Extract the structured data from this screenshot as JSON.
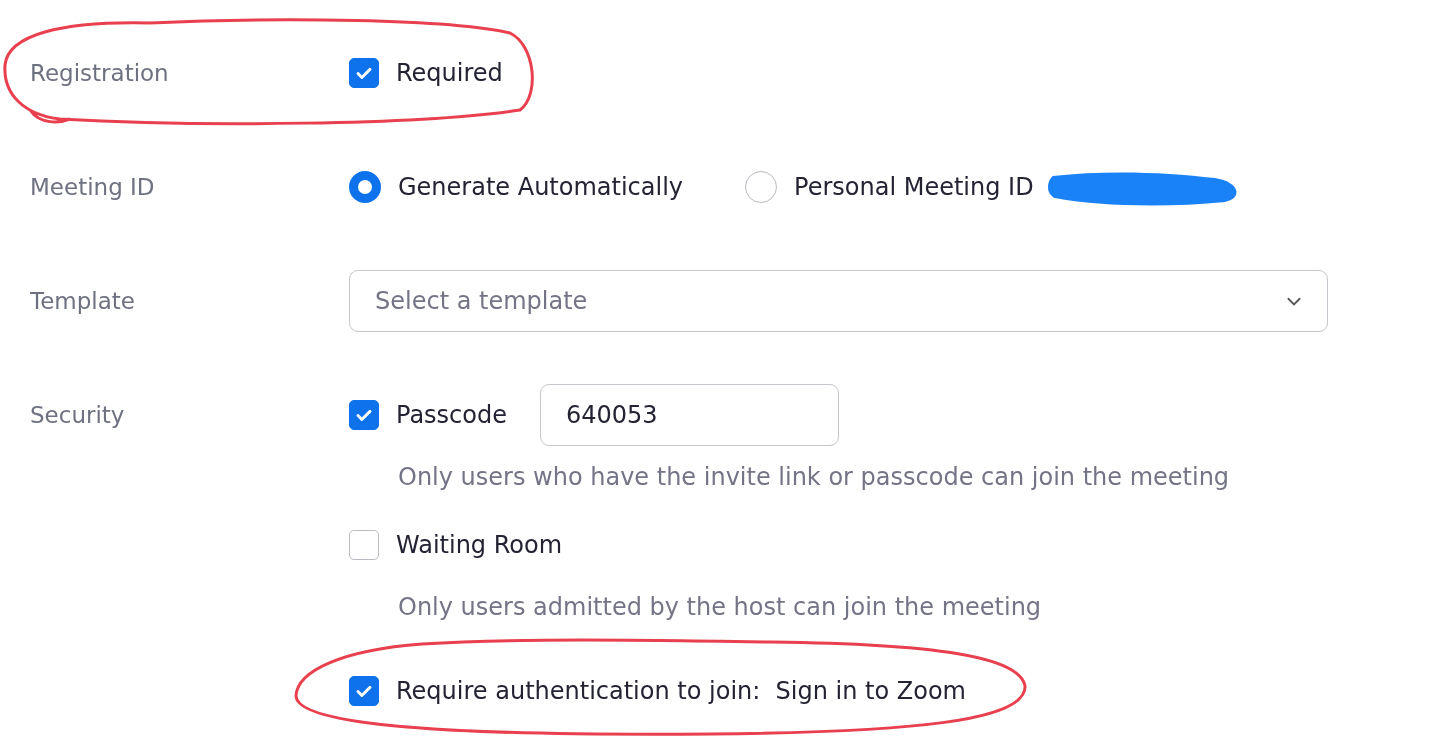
{
  "rows": [
    {
      "label": "Registration",
      "kind": "checkbox",
      "options": [
        {
          "label": "Required",
          "checked": true
        }
      ]
    },
    {
      "label": "Meeting ID",
      "kind": "radio",
      "options": [
        {
          "label": "Generate Automatically",
          "selected": true
        },
        {
          "label": "Personal Meeting ID",
          "selected": false
        }
      ]
    },
    {
      "label": "Template",
      "kind": "select",
      "placeholder": "Select a template"
    },
    {
      "label": "Security",
      "kind": "security",
      "items": [
        {
          "label": "Passcode",
          "checked": true,
          "value": "640053",
          "hint": "Only users who have the invite link or passcode can join the meeting"
        },
        {
          "label": "Waiting Room",
          "checked": false,
          "hint": "Only users admitted by the host can join the meeting"
        },
        {
          "label": "Require authentication to join:  Sign in to Zoom",
          "checked": true
        }
      ]
    }
  ]
}
